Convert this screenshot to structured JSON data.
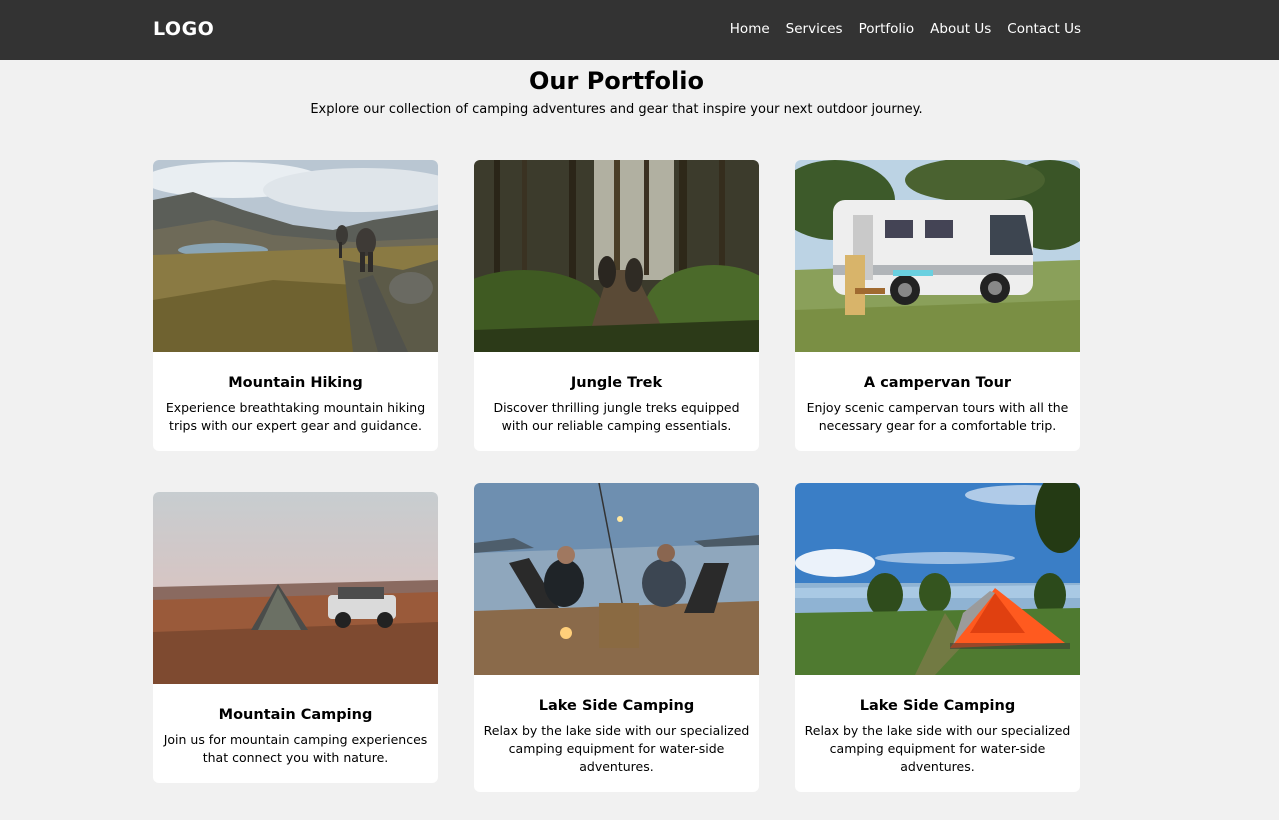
{
  "header": {
    "logo": "LOGO",
    "nav": [
      "Home",
      "Services",
      "Portfolio",
      "About Us",
      "Contact Us"
    ]
  },
  "portfolio": {
    "title": "Our Portfolio",
    "subtitle": "Explore our collection of camping adventures and gear that inspire your next outdoor journey."
  },
  "cards": [
    {
      "title": "Mountain Hiking",
      "description": "Experience breathtaking mountain hiking trips with our expert gear and guidance.",
      "image": "mountain-hiking-photo"
    },
    {
      "title": "Jungle Trek",
      "description": "Discover thrilling jungle treks equipped with our reliable camping essentials.",
      "image": "jungle-trek-photo"
    },
    {
      "title": "A campervan Tour",
      "description": "Enjoy scenic campervan tours with all the necessary gear for a comfortable trip.",
      "image": "campervan-photo"
    },
    {
      "title": "Mountain Camping",
      "description": "Join us for mountain camping experiences that connect you with nature.",
      "image": "mountain-camping-photo"
    },
    {
      "title": "Lake Side Camping",
      "description": "Relax by the lake side with our specialized camping equipment for water-side adventures.",
      "image": "lakeside-dusk-photo"
    },
    {
      "title": "Lake Side Camping",
      "description": "Relax by the lake side with our specialized camping equipment for water-side adventures.",
      "image": "lakeside-tent-photo"
    }
  ],
  "colors": {
    "navbar": "#333333",
    "background": "#f1f1f1",
    "card": "#ffffff"
  }
}
